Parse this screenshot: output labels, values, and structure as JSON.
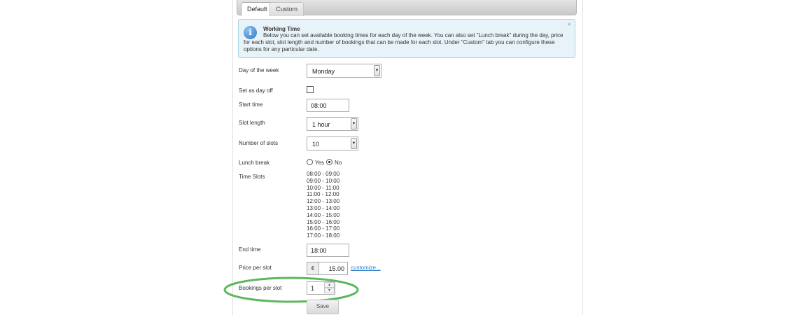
{
  "tabs": [
    {
      "label": "Default",
      "active": true
    },
    {
      "label": "Custom",
      "active": false
    }
  ],
  "info": {
    "icon": "info-icon",
    "close": "×",
    "title": "Working Time",
    "text": "Below you can set available booking times for each day of the week. You can also set \"Lunch break\" during the day, price for each slot, slot length and number of bookings that can be made for each slot. Under \"Custom\" tab you can configure these options for any particular date."
  },
  "form": {
    "day_of_week": {
      "label": "Day of the week",
      "value": "Monday"
    },
    "day_off": {
      "label": "Set as day off",
      "checked": false
    },
    "start_time": {
      "label": "Start time",
      "value": "08:00"
    },
    "slot_length": {
      "label": "Slot length",
      "value": "1 hour"
    },
    "number_of_slots": {
      "label": "Number of slots",
      "value": "10"
    },
    "lunch_break": {
      "label": "Lunch break",
      "yes": "Yes",
      "no": "No",
      "selected": "No"
    },
    "time_slots": {
      "label": "Time Slots",
      "items": [
        "08:00 - 09:00",
        "09:00 - 10:00",
        "10:00 - 11:00",
        "11:00 - 12:00",
        "12:00 - 13:00",
        "13:00 - 14:00",
        "14:00 - 15:00",
        "15:00 - 16:00",
        "16:00 - 17:00",
        "17:00 - 18:00"
      ]
    },
    "end_time": {
      "label": "End time",
      "value": "18:00"
    },
    "price_per_slot": {
      "label": "Price per slot",
      "currency": "€",
      "value": "15.00",
      "link": "customize..."
    },
    "bookings_per_slot": {
      "label": "Bookings per slot",
      "value": "1"
    },
    "save_label": "Save"
  },
  "colors": {
    "highlight": "#5cb85c",
    "info_background": "#e7f3f8",
    "link": "#2a7ec8"
  }
}
